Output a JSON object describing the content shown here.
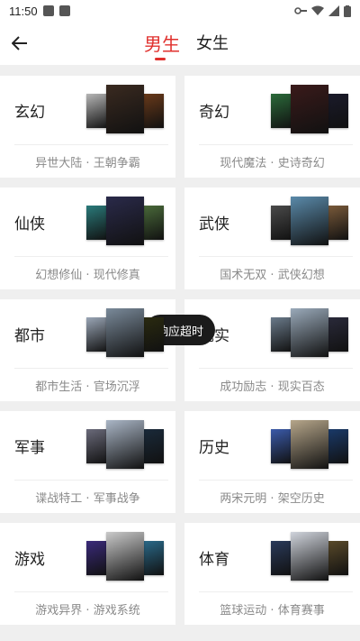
{
  "status": {
    "time": "11:50"
  },
  "tabs": {
    "male": "男生",
    "female": "女生"
  },
  "categories": [
    {
      "name": "玄幻",
      "sub": "异世大陆 · 王朝争霸",
      "colors": [
        "#b6b6b6",
        "#6a3a1a",
        "#3a2a20"
      ]
    },
    {
      "name": "奇幻",
      "sub": "现代魔法 · 史诗奇幻",
      "colors": [
        "#2b6a3a",
        "#1a1a2a",
        "#3a1a1a"
      ]
    },
    {
      "name": "仙侠",
      "sub": "幻想修仙 · 现代修真",
      "colors": [
        "#2a7a7a",
        "#4a6a3a",
        "#2a2a4a"
      ]
    },
    {
      "name": "武侠",
      "sub": "国术无双 · 武侠幻想",
      "colors": [
        "#4a4a4a",
        "#7a5a3a",
        "#5a8aaa"
      ]
    },
    {
      "name": "都市",
      "sub": "都市生活 · 官场沉浮",
      "colors": [
        "#9aa6b6",
        "#2a2a10",
        "#7a8a9a"
      ]
    },
    {
      "name": "现实",
      "sub": "成功励志 · 现实百态",
      "colors": [
        "#6a7a8a",
        "#2a2a3a",
        "#9aaaba"
      ]
    },
    {
      "name": "军事",
      "sub": "谍战特工 · 军事战争",
      "colors": [
        "#6a6a7a",
        "#1a2a3a",
        "#aab6c6"
      ]
    },
    {
      "name": "历史",
      "sub": "两宋元明 · 架空历史",
      "colors": [
        "#3a5aaa",
        "#1a3a6a",
        "#b6a68a"
      ]
    },
    {
      "name": "游戏",
      "sub": "游戏异界 · 游戏系统",
      "colors": [
        "#3a2a7a",
        "#2a6a8a",
        "#cacaca"
      ]
    },
    {
      "name": "体育",
      "sub": "篮球运动 · 体育赛事",
      "colors": [
        "#2a3a5a",
        "#5a4a2a",
        "#d0d4dc"
      ]
    }
  ],
  "toast": "响应超时"
}
